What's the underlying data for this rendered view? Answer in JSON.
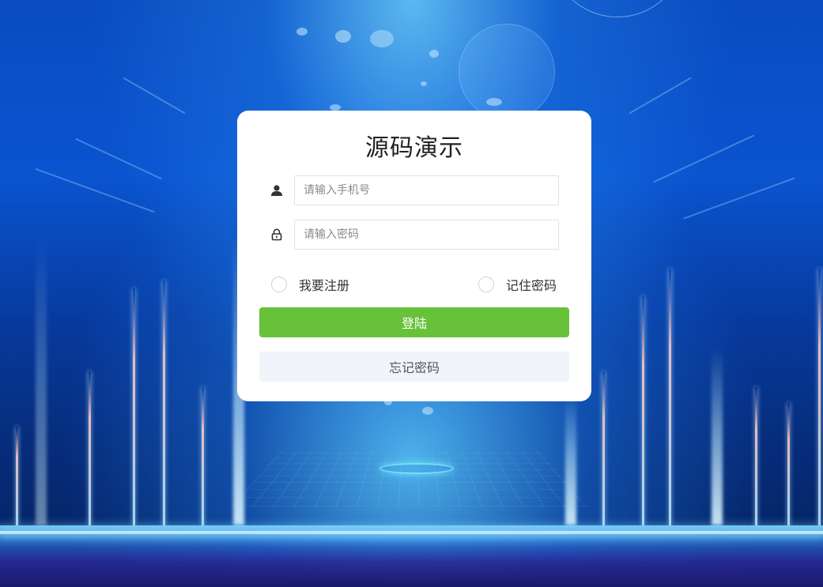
{
  "login_card": {
    "title": "源码演示",
    "phone_field": {
      "icon": "user-icon",
      "placeholder": "请输入手机号",
      "value": ""
    },
    "password_field": {
      "icon": "lock-icon",
      "placeholder": "请输入密码",
      "value": ""
    },
    "register_option": {
      "label": "我要注册",
      "checked": false
    },
    "remember_option": {
      "label": "记住密码",
      "checked": false
    },
    "login_button": {
      "label": "登陆",
      "color": "#67c23a"
    },
    "forgot_button": {
      "label": "忘记密码",
      "color": "#f1f4fa"
    }
  },
  "theme": {
    "background": "blue technology light-beam backdrop",
    "card_background": "#ffffff",
    "text_color": "#333333"
  }
}
